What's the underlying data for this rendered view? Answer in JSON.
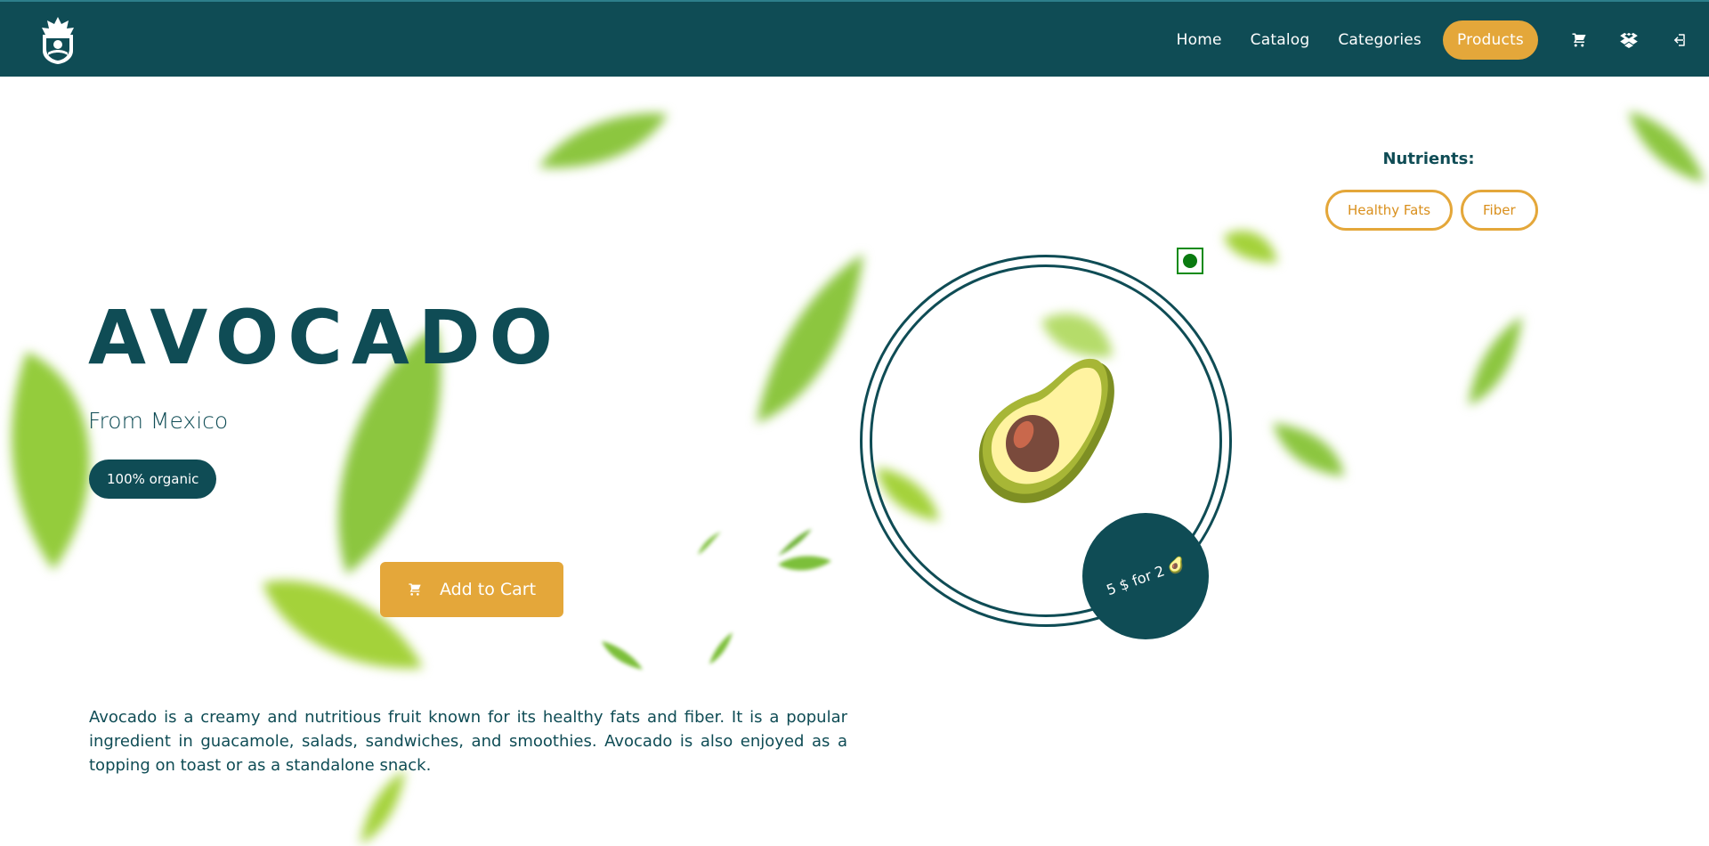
{
  "header": {
    "nav": [
      {
        "label": "Home"
      },
      {
        "label": "Catalog"
      },
      {
        "label": "Categories"
      },
      {
        "label": "Products",
        "active": true
      }
    ],
    "icons": [
      "cart-icon",
      "dropbox-icon",
      "login-icon"
    ],
    "colors": {
      "bar": "#0f4c55",
      "accent": "#e4a73a"
    }
  },
  "product": {
    "name": "AVOCADO",
    "origin": "From Mexico",
    "badge": "100% organic",
    "add_to_cart_label": "Add to Cart",
    "offer": "5 $ for 2 🥑",
    "description": "Avocado is a creamy and nutritious fruit known for its healthy fats and fiber. It is a popular ingredient in guacamole, salads, sandwiches, and smoothies. Avocado is also enjoyed as a topping on toast or as a standalone snack."
  },
  "nutrients": {
    "title": "Nutrients:",
    "items": [
      "Healthy Fats",
      "Fiber"
    ]
  }
}
